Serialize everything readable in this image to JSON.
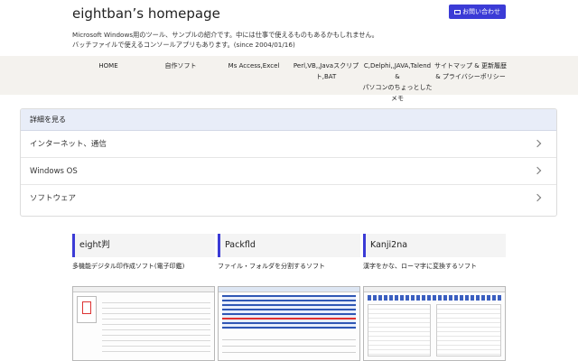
{
  "site": {
    "title": "eightban’s homepage",
    "contact_label": "お問い合わせ",
    "description_line1": "Microsoft Windows用のツール、サンプルの紹介です。中には仕事で使えるものもあるかもしれません。",
    "description_line2": "バッチファイルで使えるコンソールアプリもあります。(since 2004/01/16)"
  },
  "nav": {
    "items": [
      {
        "line1": "HOME",
        "line2": "",
        "line3": ""
      },
      {
        "line1": "自作ソフト",
        "line2": "",
        "line3": ""
      },
      {
        "line1": "Ms Access,Excel",
        "line2": "",
        "line3": ""
      },
      {
        "line1": "Perl,VB,,Javaスクリプ",
        "line2": "ト,BAT",
        "line3": ""
      },
      {
        "line1": "C,Delphi,,JAVA,Talend &",
        "line2": "パソコンのちょっとした",
        "line3": "メモ"
      },
      {
        "line1": "サイトマップ & 更新履歴",
        "line2": "& プライバシーポリシー",
        "line3": ""
      }
    ]
  },
  "panel": {
    "header": "詳細を見る",
    "rows": [
      "インターネット、通信",
      "Windows OS",
      "ソフトウェア"
    ]
  },
  "cards": [
    {
      "title": "eight判",
      "subtitle": "多機能デジタル印作成ソフト(電子印鑑)"
    },
    {
      "title": "Packfld",
      "subtitle": "ファイル・フォルダを分割するソフト"
    },
    {
      "title": "Kanji2na",
      "subtitle": "漢字をかな、ローマ字に変換するソフト"
    }
  ],
  "colors": {
    "accent": "#3b3bd6",
    "nav_bg": "#f4f2ee",
    "panel_header_bg": "#e8edf8"
  },
  "icons": {
    "contact": "mail-icon",
    "row": "chevron-right-icon"
  }
}
